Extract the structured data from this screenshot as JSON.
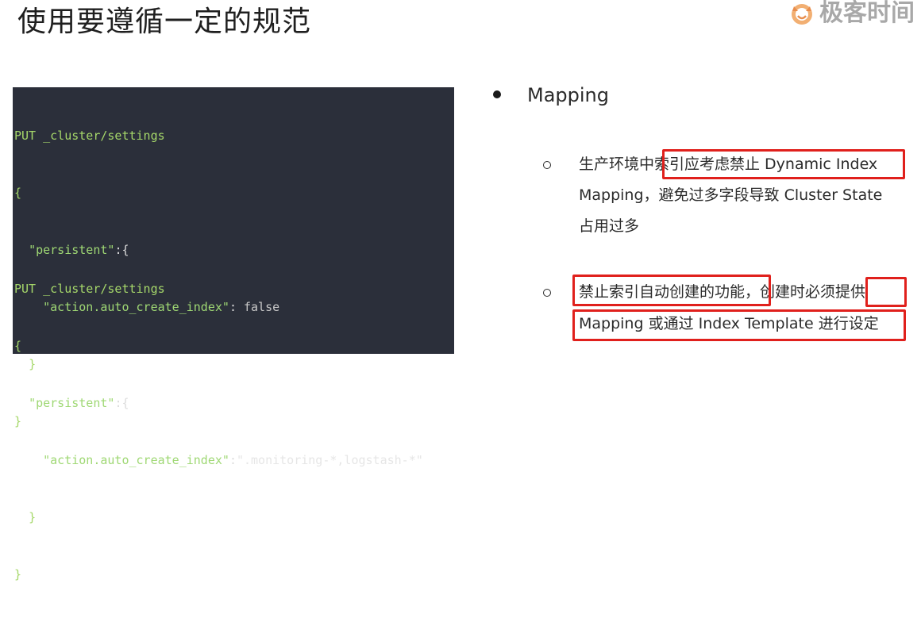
{
  "slide": {
    "title": "使用要遵循一定的规范"
  },
  "logo": {
    "icon": "geek-time-logo-icon",
    "text": "极客时间"
  },
  "code": {
    "block1": {
      "line1": "PUT _cluster/settings",
      "line2": "{",
      "line3_key": "\"persistent\"",
      "line3_rest": ":{",
      "line4_key": "\"action.auto_create_index\"",
      "line4_sep": ": ",
      "line4_val": "false",
      "line5": "}",
      "line6": "}"
    },
    "block2": {
      "line1": "PUT _cluster/settings",
      "line2": "{",
      "line3_key": "\"persistent\"",
      "line3_rest": ":{",
      "line4_key": "\"action.auto_create_index\"",
      "line4_sep": ":",
      "line4_val": "\".monitoring-*,logstash-*\"",
      "line5": "}",
      "line6": "}"
    }
  },
  "bullets": {
    "main": "Mapping",
    "sub1": {
      "line1": "生产环境中索引应考虑禁止 Dynamic Index",
      "line2": "Mapping，避免过多字段导致 Cluster State",
      "line3": "占用过多"
    },
    "sub2": {
      "line1": "禁止索引自动创建的功能，创建时必须提供",
      "line2": "Mapping 或通过 Index Template 进行设定"
    }
  },
  "colors": {
    "highlight_box": "#e0201c",
    "code_background": "#2b2f3a",
    "code_keyword": "#a6d86a"
  }
}
